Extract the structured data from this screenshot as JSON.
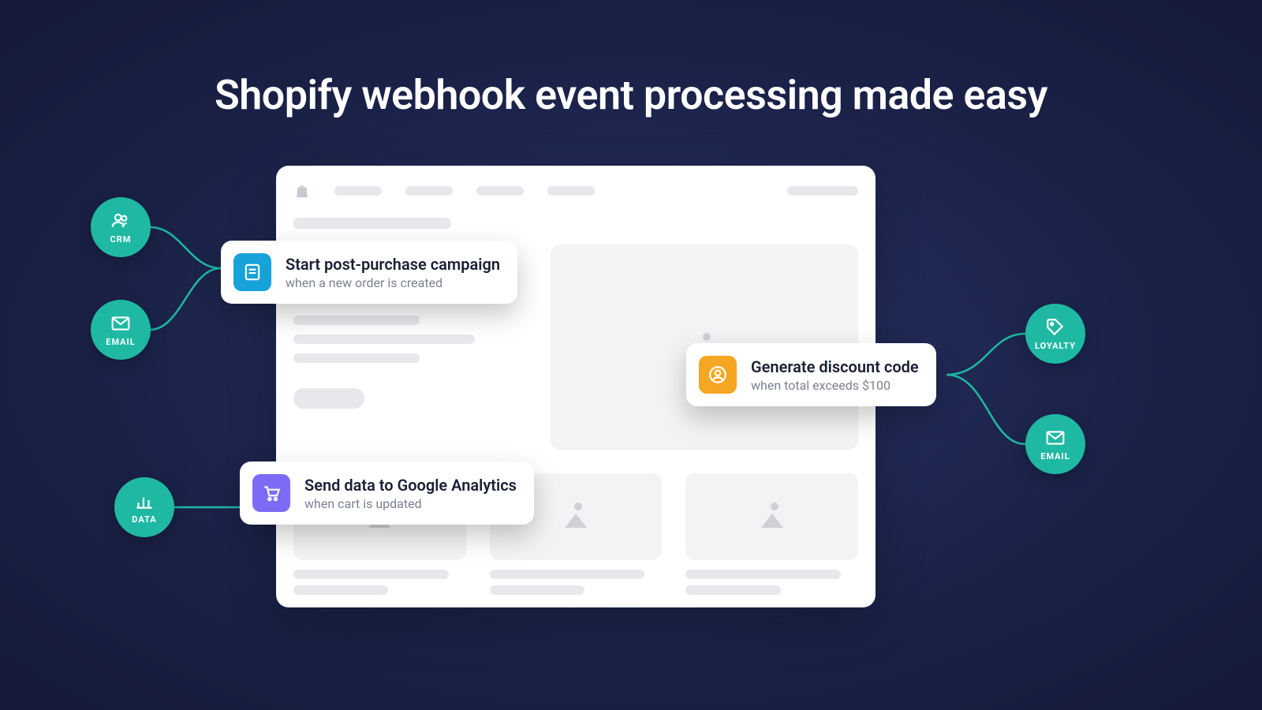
{
  "headline": "Shopify webhook event processing made easy",
  "bubbles": {
    "crm": "CRM",
    "email_left": "EMAIL",
    "data": "DATA",
    "loyalty": "LOYALTY",
    "email_right": "EMAIL"
  },
  "cards": {
    "campaign": {
      "title": "Start post-purchase campaign",
      "sub": "when a new order is created",
      "color": "blue",
      "icon": "receipt"
    },
    "analytics": {
      "title": "Send data to Google Analytics",
      "sub": "when cart is updated",
      "color": "purple",
      "icon": "cart"
    },
    "discount": {
      "title": "Generate discount code",
      "sub": "when total exceeds $100",
      "color": "orange",
      "icon": "avatar"
    }
  },
  "colors": {
    "accent": "#1fb9a3",
    "card_blue": "#17a2d9",
    "card_purple": "#7c6cf5",
    "card_orange": "#f5a623"
  }
}
